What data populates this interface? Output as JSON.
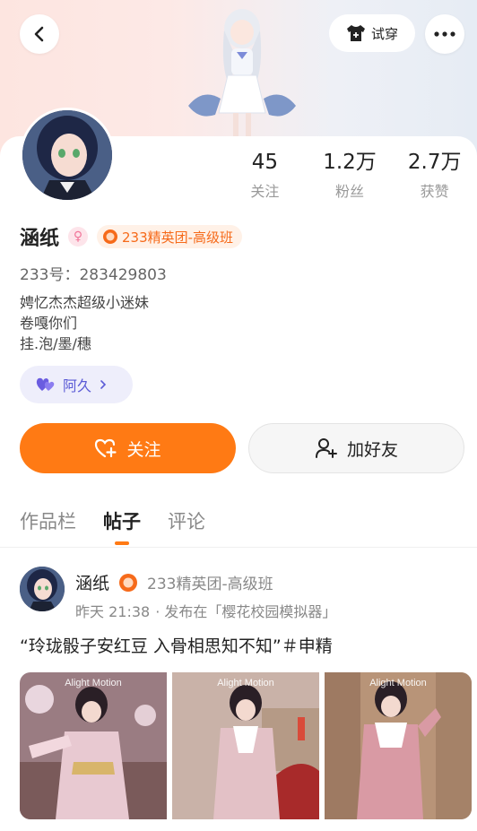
{
  "header": {
    "try_on_label": "试穿"
  },
  "profile": {
    "stats": [
      {
        "value": "45",
        "label": "关注"
      },
      {
        "value": "1.2万",
        "label": "粉丝"
      },
      {
        "value": "2.7万",
        "label": "获赞"
      }
    ],
    "nickname": "涵纸",
    "gender_symbol": "♀",
    "level_badge": "233精英团-高级班",
    "uid": "233号：283429803",
    "bio": [
      "娉忆杰杰超级小迷妹",
      "卷嘎你们",
      "挂.泡/墨/穗"
    ],
    "tag_chip_label": "阿久",
    "follow_label": "关注",
    "add_friend_label": "加好友"
  },
  "tabs": [
    {
      "label": "作品栏",
      "active": false
    },
    {
      "label": "帖子",
      "active": true
    },
    {
      "label": "评论",
      "active": false
    }
  ],
  "post": {
    "author": "涵纸",
    "author_level": "233精英团-高级班",
    "time": "昨天 21:38",
    "source": "· 发布在「樱花校园模拟器」",
    "title": "“玲珑骰子安红豆 入骨相思知不知”＃申精",
    "thumbnails": [
      {
        "watermark": "Alight Motion"
      },
      {
        "watermark": "Alight Motion"
      },
      {
        "watermark": "Alight Motion"
      }
    ]
  },
  "colors": {
    "accent": "#ff7a14",
    "level_text": "#f66a1a",
    "chip_text": "#5b5bd6"
  }
}
